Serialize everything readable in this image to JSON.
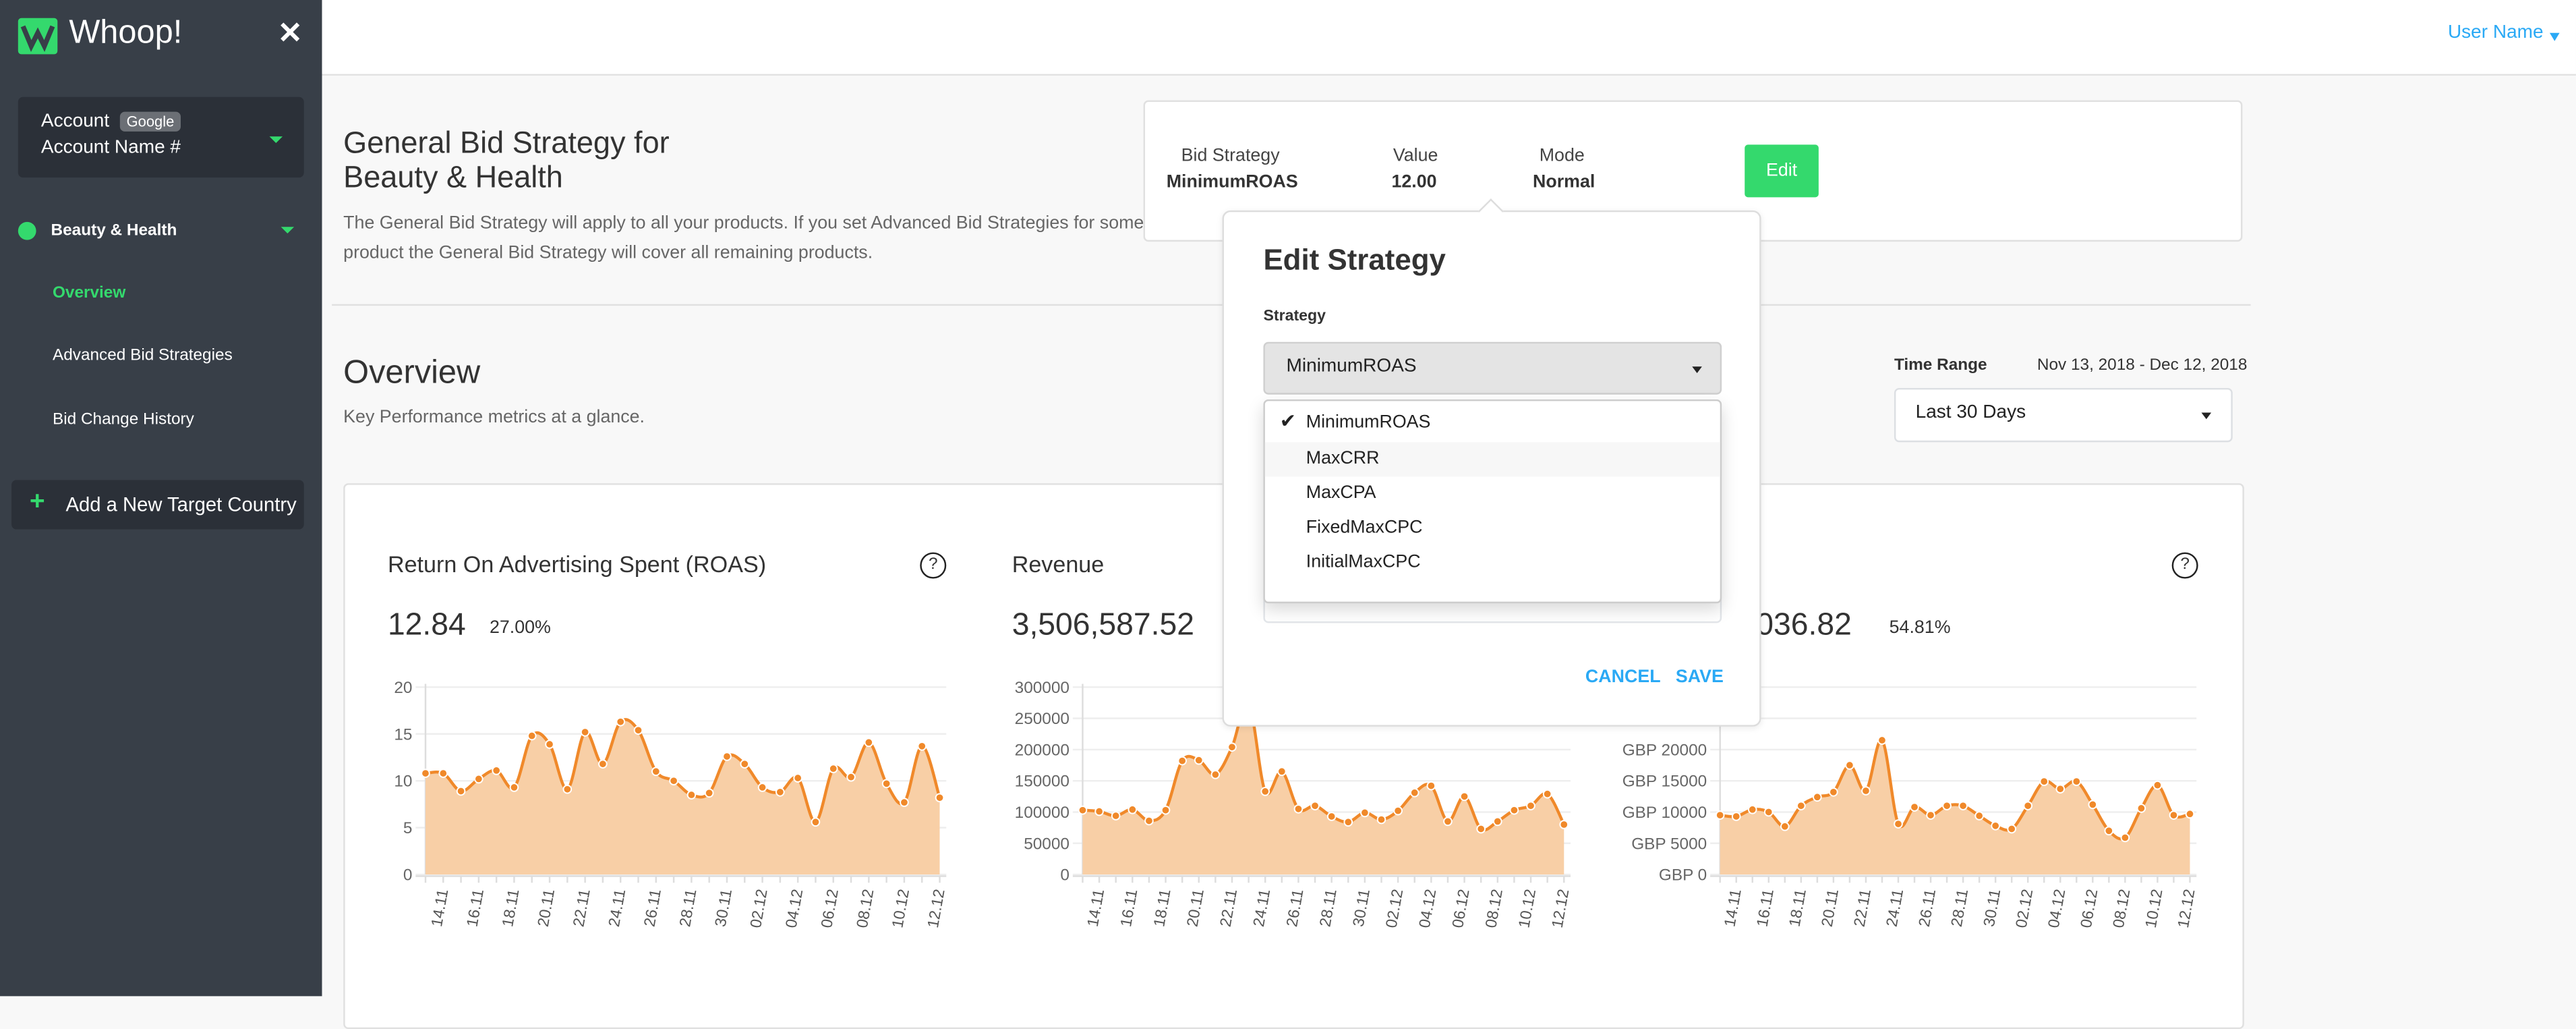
{
  "sidebar": {
    "brand": "Whoop!",
    "account": {
      "label": "Account",
      "badge": "Google",
      "name": "Account Name #"
    },
    "group": "Beauty & Health",
    "items": [
      {
        "label": "Overview",
        "active": true
      },
      {
        "label": "Advanced Bid Strategies",
        "active": false
      },
      {
        "label": "Bid Change History",
        "active": false
      }
    ],
    "add_country": "Add a New Target Country"
  },
  "header": {
    "user": "User Name"
  },
  "strategy": {
    "title": "General Bid Strategy for Beauty & Health",
    "description": "The General Bid Strategy will apply to all your products. If you set Advanced Bid Strategies for some product the General Bid Strategy will cover all remaining products.",
    "bid_strategy_label": "Bid Strategy",
    "bid_strategy_value": "MinimumROAS",
    "value_label": "Value",
    "value_value": "12.00",
    "mode_label": "Mode",
    "mode_value": "Normal",
    "edit_label": "Edit"
  },
  "overview": {
    "title": "Overview",
    "subtitle": "Key Performance metrics at a glance.",
    "time_range_label": "Time Range",
    "time_range_dates": "Nov 13, 2018 - Dec 12, 2018",
    "time_range_selected": "Last 30 Days"
  },
  "cards": [
    {
      "title": "Return On Advertising Spent (ROAS)",
      "value": "12.84",
      "change": "27.00%",
      "help": "?"
    },
    {
      "title": "Revenue",
      "value": "3,506,587.52",
      "change": "",
      "help": "?"
    },
    {
      "title": "",
      "value": "036.82",
      "change": "54.81%",
      "help": "?"
    }
  ],
  "popup": {
    "title": "Edit Strategy",
    "strategy_label": "Strategy",
    "selected": "MinimumROAS",
    "options": [
      "MinimumROAS",
      "MaxCRR",
      "MaxCPA",
      "FixedMaxCPC",
      "InitialMaxCPC"
    ],
    "hovered": "MaxCRR",
    "cancel": "CANCEL",
    "save": "SAVE"
  },
  "colors": {
    "brand_green": "#34d96d",
    "link_blue": "#2aa9f5",
    "series_line": "#f0892a",
    "series_fill": "#f8cfa6",
    "sidebar_bg": "#383f48"
  },
  "icons": {
    "close": "close-icon",
    "caret": "caret-down-icon",
    "globe": "globe-icon",
    "plus": "plus-icon",
    "help": "help-circle-icon",
    "check": "check-icon"
  },
  "chart_data": [
    {
      "type": "area",
      "x": [
        "13.11",
        "14.11",
        "15.11",
        "16.11",
        "17.11",
        "18.11",
        "19.11",
        "20.11",
        "21.11",
        "22.11",
        "23.11",
        "24.11",
        "25.11",
        "26.11",
        "27.11",
        "28.11",
        "29.11",
        "30.11",
        "01.12",
        "02.12",
        "03.12",
        "04.12",
        "05.12",
        "06.12",
        "07.12",
        "08.12",
        "09.12",
        "10.12",
        "11.12",
        "12.12"
      ],
      "xtick_labels": [
        "14.11",
        "16.11",
        "18.11",
        "20.11",
        "22.11",
        "24.11",
        "26.11",
        "28.11",
        "30.11",
        "02.12",
        "04.12",
        "06.12",
        "08.12",
        "10.12",
        "12.12"
      ],
      "values": [
        10.8,
        10.8,
        8.9,
        10.2,
        11.1,
        9.3,
        14.8,
        13.9,
        9.1,
        15.2,
        11.8,
        16.3,
        15.4,
        11.0,
        10.0,
        8.5,
        8.7,
        12.6,
        11.8,
        9.3,
        8.8,
        10.3,
        5.6,
        11.3,
        10.4,
        14.1,
        9.7,
        7.7,
        13.7,
        8.2
      ],
      "ylim": [
        0,
        20
      ],
      "yticks": [
        "0",
        "5",
        "10",
        "15",
        "20"
      ],
      "grid": true
    },
    {
      "type": "area",
      "x": [
        "13.11",
        "14.11",
        "15.11",
        "16.11",
        "17.11",
        "18.11",
        "19.11",
        "20.11",
        "21.11",
        "22.11",
        "23.11",
        "24.11",
        "25.11",
        "26.11",
        "27.11",
        "28.11",
        "29.11",
        "30.11",
        "01.12",
        "02.12",
        "03.12",
        "04.12",
        "05.12",
        "06.12",
        "07.12",
        "08.12",
        "09.12",
        "10.12",
        "11.12",
        "12.12"
      ],
      "xtick_labels": [
        "14.11",
        "16.11",
        "18.11",
        "20.11",
        "22.11",
        "24.11",
        "26.11",
        "28.11",
        "30.11",
        "02.12",
        "04.12",
        "06.12",
        "08.12",
        "10.12",
        "12.12"
      ],
      "values": [
        103000,
        101000,
        94000,
        104000,
        86000,
        103000,
        182000,
        183000,
        160000,
        204000,
        275000,
        133000,
        165000,
        105000,
        110000,
        93000,
        84000,
        99000,
        88000,
        102000,
        131000,
        142000,
        85000,
        125000,
        73000,
        85000,
        103000,
        110000,
        129000,
        80000
      ],
      "ylim": [
        0,
        300000
      ],
      "yticks": [
        "0",
        "50000",
        "100000",
        "150000",
        "200000",
        "250000",
        "300000"
      ],
      "grid": true
    },
    {
      "type": "area",
      "x": [
        "13.11",
        "14.11",
        "15.11",
        "16.11",
        "17.11",
        "18.11",
        "19.11",
        "20.11",
        "21.11",
        "22.11",
        "23.11",
        "24.11",
        "25.11",
        "26.11",
        "27.11",
        "28.11",
        "29.11",
        "30.11",
        "01.12",
        "02.12",
        "03.12",
        "04.12",
        "05.12",
        "06.12",
        "07.12",
        "08.12",
        "09.12",
        "10.12",
        "11.12",
        "12.12"
      ],
      "xtick_labels": [
        "14.11",
        "16.11",
        "18.11",
        "20.11",
        "22.11",
        "24.11",
        "26.11",
        "28.11",
        "30.11",
        "02.12",
        "04.12",
        "06.12",
        "08.12",
        "10.12",
        "12.12"
      ],
      "values": [
        9500,
        9300,
        10400,
        10000,
        7700,
        11000,
        12400,
        13200,
        17500,
        13400,
        21500,
        8100,
        10800,
        9500,
        11000,
        11000,
        9400,
        7800,
        7300,
        11000,
        14900,
        13700,
        14900,
        11200,
        7000,
        5900,
        10600,
        14300,
        9500,
        9700
      ],
      "ylim": [
        0,
        30000
      ],
      "yticks": [
        "GBP 0",
        "GBP 5000",
        "GBP 10000",
        "GBP 15000",
        "GBP 20000"
      ],
      "grid": true
    }
  ]
}
